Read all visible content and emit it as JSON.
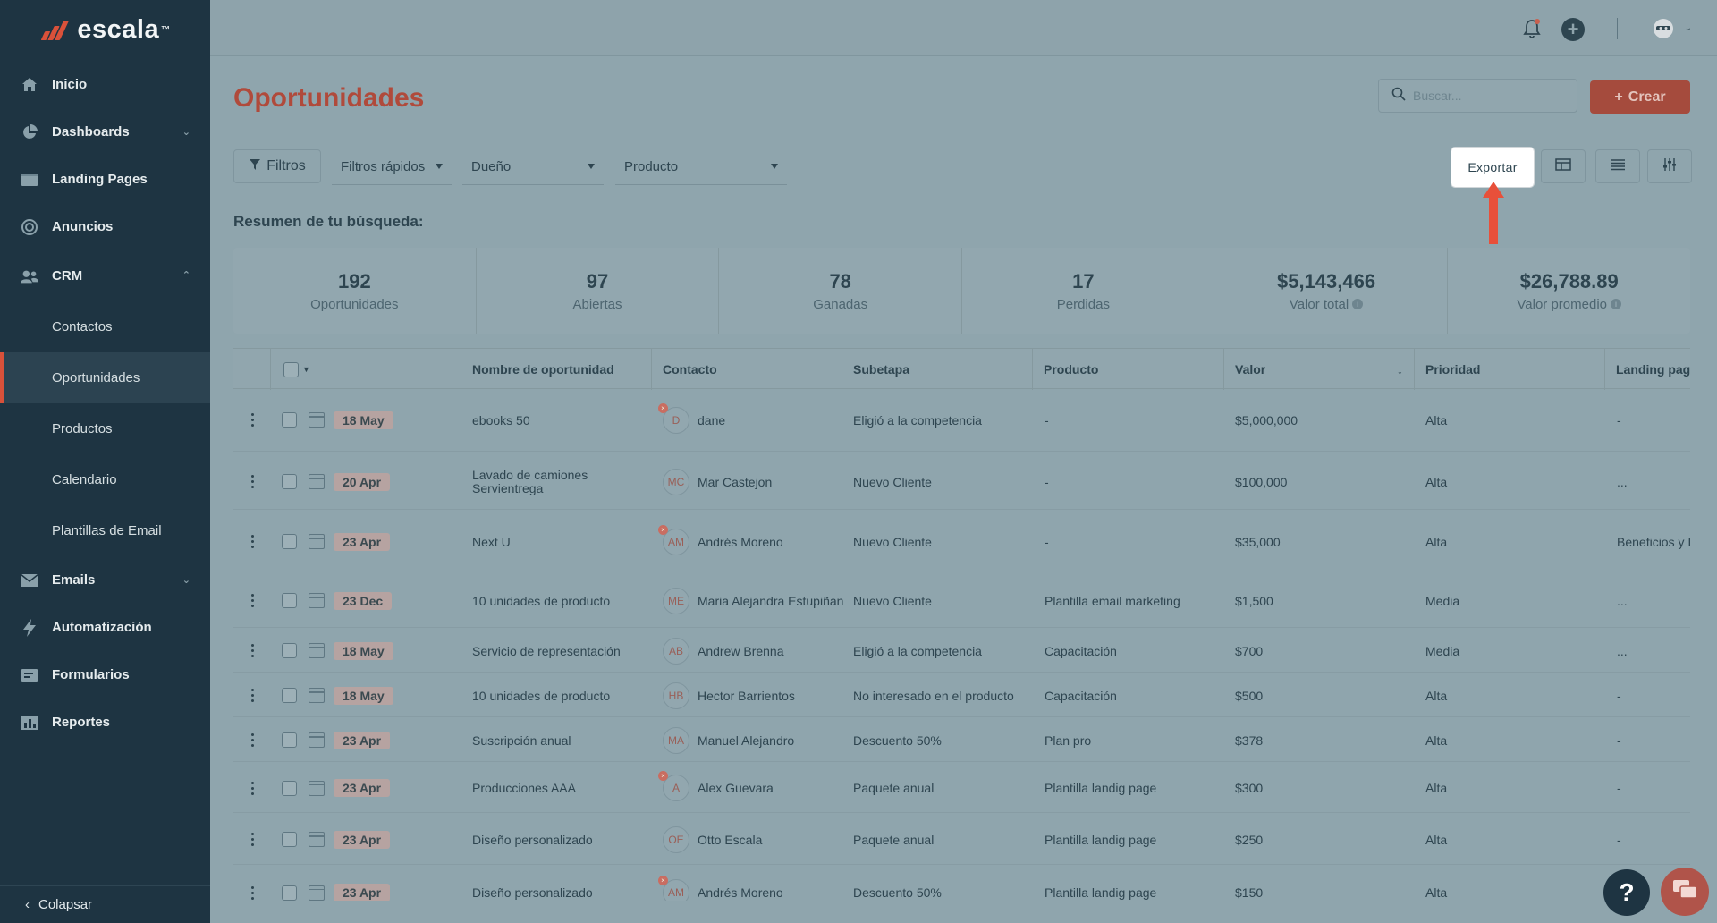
{
  "app": {
    "logo_text": "escala",
    "logo_tm": "™",
    "colors": {
      "sidebar": "#1e3442",
      "accent": "#d9513a",
      "overlay": "#8fa5ad"
    }
  },
  "sidebar": {
    "items": [
      {
        "label": "Inicio",
        "icon": "home-icon"
      },
      {
        "label": "Dashboards",
        "icon": "pie-chart-icon",
        "expandable": true
      },
      {
        "label": "Landing Pages",
        "icon": "window-icon"
      },
      {
        "label": "Anuncios",
        "icon": "target-icon"
      },
      {
        "label": "CRM",
        "icon": "users-icon",
        "expanded": true
      }
    ],
    "crm_sub": [
      "Contactos",
      "Oportunidades",
      "Productos",
      "Calendario",
      "Plantillas de Email"
    ],
    "items_after": [
      {
        "label": "Emails",
        "icon": "mail-icon"
      },
      {
        "label": "Automatización",
        "icon": "bolt-icon"
      },
      {
        "label": "Formularios",
        "icon": "form-icon"
      },
      {
        "label": "Reportes",
        "icon": "report-icon"
      }
    ],
    "collapse_label": "Colapsar"
  },
  "header": {
    "title": "Oportunidades",
    "search_placeholder": "Buscar...",
    "create_label": "Crear"
  },
  "filters": {
    "filtros_label": "Filtros",
    "quick_label": "Filtros rápidos",
    "owner_label": "Dueño",
    "product_label": "Producto",
    "export_label": "Exportar"
  },
  "summary": {
    "title": "Resumen de tu búsqueda:",
    "stats": [
      {
        "value": "192",
        "label": "Oportunidades"
      },
      {
        "value": "97",
        "label": "Abiertas"
      },
      {
        "value": "78",
        "label": "Ganadas"
      },
      {
        "value": "17",
        "label": "Perdidas"
      },
      {
        "value": "$5,143,466",
        "label": "Valor total"
      },
      {
        "value": "$26,788.89",
        "label": "Valor promedio"
      }
    ]
  },
  "table": {
    "columns": [
      "Nombre de oportunidad",
      "Contacto",
      "Subetapa",
      "Producto",
      "Valor",
      "Prioridad",
      "Landing pag"
    ],
    "rows": [
      {
        "date": "18 May",
        "name": "ebooks 50",
        "initials": "D",
        "contact": "dane",
        "sub": "Eligió a la competencia",
        "product": "-",
        "value": "$5,000,000",
        "priority": "Alta",
        "landing": "-"
      },
      {
        "date": "20 Apr",
        "name": "Lavado de camiones Servientrega",
        "initials": "MC",
        "contact": "Mar Castejon",
        "sub": "Nuevo Cliente",
        "product": "-",
        "value": "$100,000",
        "priority": "Alta",
        "landing": "..."
      },
      {
        "date": "23 Apr",
        "name": "Next U",
        "initials": "AM",
        "contact": "Andrés Moreno",
        "sub": "Nuevo Cliente",
        "product": "-",
        "value": "$35,000",
        "priority": "Alta",
        "landing": "Beneficios y I"
      },
      {
        "date": "23 Dec",
        "name": "10 unidades de producto",
        "initials": "ME",
        "contact": "Maria Alejandra Estupiñan",
        "sub": "Nuevo Cliente",
        "product": "Plantilla email marketing",
        "value": "$1,500",
        "priority": "Media",
        "landing": "..."
      },
      {
        "date": "18 May",
        "name": "Servicio de representación",
        "initials": "AB",
        "contact": "Andrew Brenna",
        "sub": "Eligió a la competencia",
        "product": "Capacitación",
        "value": "$700",
        "priority": "Media",
        "landing": "..."
      },
      {
        "date": "18 May",
        "name": "10 unidades de producto",
        "initials": "HB",
        "contact": "Hector Barrientos",
        "sub": "No interesado en el producto",
        "product": "Capacitación",
        "value": "$500",
        "priority": "Alta",
        "landing": "-"
      },
      {
        "date": "23 Apr",
        "name": "Suscripción anual",
        "initials": "MA",
        "contact": "Manuel Alejandro",
        "sub": "Descuento 50%",
        "product": "Plan pro",
        "value": "$378",
        "priority": "Alta",
        "landing": "-"
      },
      {
        "date": "23 Apr",
        "name": "Producciones AAA",
        "initials": "A",
        "contact": "Alex Guevara",
        "sub": "Paquete anual",
        "product": "Plantilla landig page",
        "value": "$300",
        "priority": "Alta",
        "landing": "-"
      },
      {
        "date": "23 Apr",
        "name": "Diseño personalizado",
        "initials": "OE",
        "contact": "Otto Escala",
        "sub": "Paquete anual",
        "product": "Plantilla landig page",
        "value": "$250",
        "priority": "Alta",
        "landing": "-"
      },
      {
        "date": "23 Apr",
        "name": "Diseño personalizado",
        "initials": "AM",
        "contact": "Andrés Moreno",
        "sub": "Descuento 50%",
        "product": "Plantilla landig page",
        "value": "$150",
        "priority": "Alta",
        "landing": "-"
      }
    ]
  },
  "help_label": "?"
}
